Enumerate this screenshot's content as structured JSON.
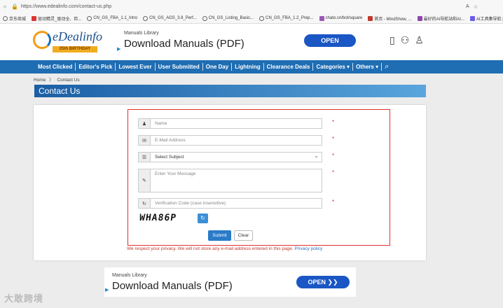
{
  "browser": {
    "url": "https://www.edealinfo.com/contact-us.php",
    "bookmarks": [
      "京东商城",
      "驱动精灵_驱动全、匹...",
      "CN_GS_FBA_1.1_Intro",
      "CN_GS_AGS_3.8_Perf...",
      "CN_GS_Listing_Basic...",
      "CN_GS_FBA_1.2_Prep...",
      "chato.cn/bot/square",
      "首页 - MindShow, ...",
      "最好的AI导航站和AI...",
      "AI工具集导航 | 500+ ..."
    ]
  },
  "logo": {
    "name": "eDealinfo",
    "tagline": "25th BIRTHDAY"
  },
  "ad_top": {
    "small": "Manuals Library",
    "big": "Download Manuals (PDF)",
    "button": "OPEN"
  },
  "nav": {
    "items": [
      "Most Clicked",
      "Editor's Pick",
      "Lowest Ever",
      "User Submitted",
      "One Day",
      "Lightning",
      "Clearance Deals",
      "Categories ▾",
      "Others ▾"
    ]
  },
  "breadcrumb": {
    "home": "Home",
    "sep": "〉",
    "current": "Contact Us"
  },
  "page_title": "Contact Us",
  "form": {
    "name_placeholder": "Name",
    "email_placeholder": "E-Mail Address",
    "subject_selected": "Select Subject",
    "message_placeholder": "Enter Your Message",
    "captcha_placeholder": "Verification Code (case insensitive)",
    "captcha_text": "WHA86P",
    "submit": "Submit",
    "clear": "Clear",
    "required_mark": "*"
  },
  "privacy": {
    "text": "We respect your privacy. We will not store any e-mail address entered in this page.",
    "link": "Privacy policy"
  },
  "ad_bottom": {
    "small": "Manuals Library",
    "big": "Download Manuals (PDF)",
    "button": "OPEN ❯❯"
  },
  "watermark": "大敢跨境"
}
